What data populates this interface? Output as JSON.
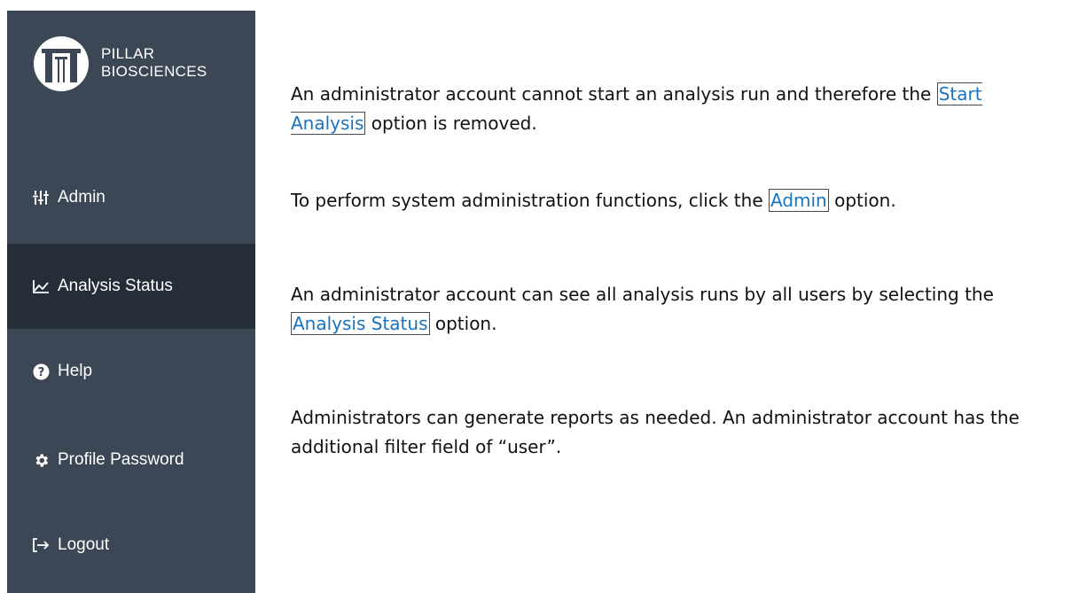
{
  "sidebar": {
    "brand": {
      "line1": "PILLAR",
      "line2": "BIOSCIENCES"
    },
    "items": [
      {
        "label": "Admin",
        "icon": "sliders-icon",
        "active": false
      },
      {
        "label": "Analysis Status",
        "icon": "line-chart-icon",
        "active": true
      },
      {
        "label": "Help",
        "icon": "question-circle-icon",
        "active": false
      },
      {
        "label": "Profile Password",
        "icon": "gear-icon",
        "active": false
      },
      {
        "label": "Logout",
        "icon": "logout-icon",
        "active": false
      }
    ]
  },
  "content": {
    "p1": {
      "before": "An administrator account cannot start an analysis run and therefore the ",
      "option": "Start Analysis",
      "after": " option is removed."
    },
    "p2": {
      "before": "To perform system administration functions, click the ",
      "option": "Admin",
      "after": " option."
    },
    "p3": {
      "before": "An administrator account can see all analysis runs by all users by selecting the ",
      "option": "Analysis Status",
      "after": " option."
    },
    "p4": {
      "text": "Administrators can generate reports as needed. An administrator account has the additional filter field of “user”."
    }
  },
  "colors": {
    "sidebar_bg": "#3b4754",
    "sidebar_active_bg": "#252e38",
    "option_link": "#1a73c0"
  }
}
